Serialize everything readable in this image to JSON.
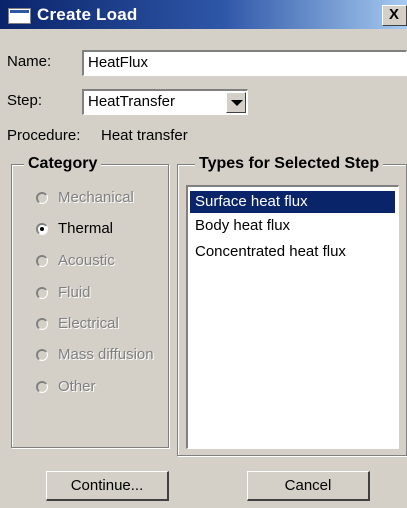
{
  "window": {
    "title": "Create Load",
    "close_glyph": "X"
  },
  "name": {
    "label": "Name:",
    "value": "HeatFlux"
  },
  "step": {
    "label": "Step:",
    "value": "HeatTransfer"
  },
  "procedure": {
    "label": "Procedure:",
    "value": "Heat transfer"
  },
  "category": {
    "title": "Category",
    "options": [
      {
        "label": "Mechanical",
        "enabled": false,
        "selected": false
      },
      {
        "label": "Thermal",
        "enabled": true,
        "selected": true
      },
      {
        "label": "Acoustic",
        "enabled": false,
        "selected": false
      },
      {
        "label": "Fluid",
        "enabled": false,
        "selected": false
      },
      {
        "label": "Electrical",
        "enabled": false,
        "selected": false
      },
      {
        "label": "Mass diffusion",
        "enabled": false,
        "selected": false
      },
      {
        "label": "Other",
        "enabled": false,
        "selected": false
      }
    ]
  },
  "types": {
    "title": "Types for Selected Step",
    "items": [
      "Surface heat flux",
      "Body heat flux",
      "Concentrated heat flux"
    ],
    "selected_index": 0
  },
  "buttons": {
    "continue": "Continue...",
    "cancel": "Cancel"
  },
  "colors": {
    "title_bar": "#0a246a",
    "dialog_bg": "#d4d0c8",
    "selection": "#0a246a"
  }
}
